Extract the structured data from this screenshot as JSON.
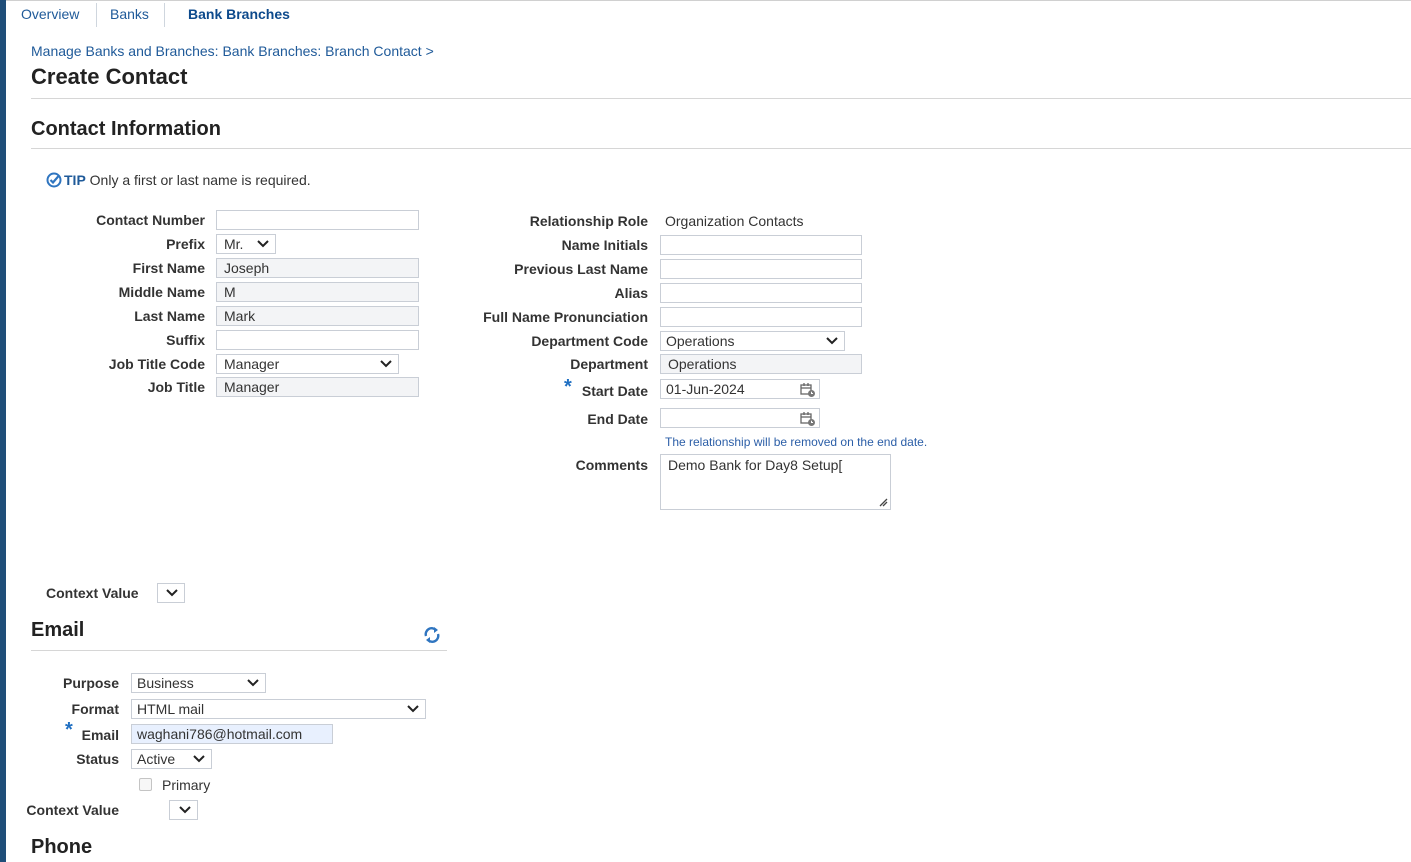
{
  "tabs": [
    {
      "label": "Overview"
    },
    {
      "label": "Banks"
    },
    {
      "label": "Bank Branches"
    }
  ],
  "breadcrumb": "Manage Banks and Branches: Bank Branches: Branch Contact  >",
  "page_title": "Create Contact",
  "contact_info": {
    "title": "Contact Information",
    "tip_label": "TIP",
    "tip_text": "Only a first or last name is required.",
    "labels": {
      "contact_number": "Contact Number",
      "prefix": "Prefix",
      "first_name": "First Name",
      "middle_name": "Middle Name",
      "last_name": "Last Name",
      "suffix": "Suffix",
      "job_title_code": "Job Title Code",
      "job_title": "Job Title",
      "relationship_role": "Relationship Role",
      "name_initials": "Name Initials",
      "previous_last_name": "Previous Last Name",
      "alias": "Alias",
      "full_name_pronunciation": "Full Name Pronunciation",
      "department_code": "Department Code",
      "department": "Department",
      "start_date": "Start Date",
      "end_date": "End Date",
      "comments": "Comments",
      "context_value": "Context Value"
    },
    "values": {
      "contact_number": "",
      "prefix": "Mr.",
      "first_name": "Joseph",
      "middle_name": "M",
      "last_name": "Mark",
      "suffix": "",
      "job_title_code": "Manager",
      "job_title": "Manager",
      "relationship_role": "Organization Contacts",
      "name_initials": "",
      "previous_last_name": "",
      "alias": "",
      "full_name_pronunciation": "",
      "department_code": "Operations",
      "department": "Operations",
      "start_date": "01-Jun-2024",
      "end_date": "",
      "comments": "Demo Bank for Day8 Setup[",
      "context_value": ""
    },
    "end_date_hint": "The relationship will be removed on the end date.",
    "required_mark": "*"
  },
  "email": {
    "title": "Email",
    "labels": {
      "purpose": "Purpose",
      "format": "Format",
      "email": "Email",
      "status": "Status",
      "primary": "Primary",
      "context_value": "Context Value"
    },
    "values": {
      "purpose": "Business",
      "format": "HTML mail",
      "email": "waghani786@hotmail.com",
      "status": "Active",
      "primary": false,
      "context_value": ""
    }
  },
  "phone": {
    "title": "Phone"
  },
  "colors": {
    "accent": "#1f5a99",
    "sidebar": "#1f4e79",
    "required": "#1f6fc2"
  }
}
